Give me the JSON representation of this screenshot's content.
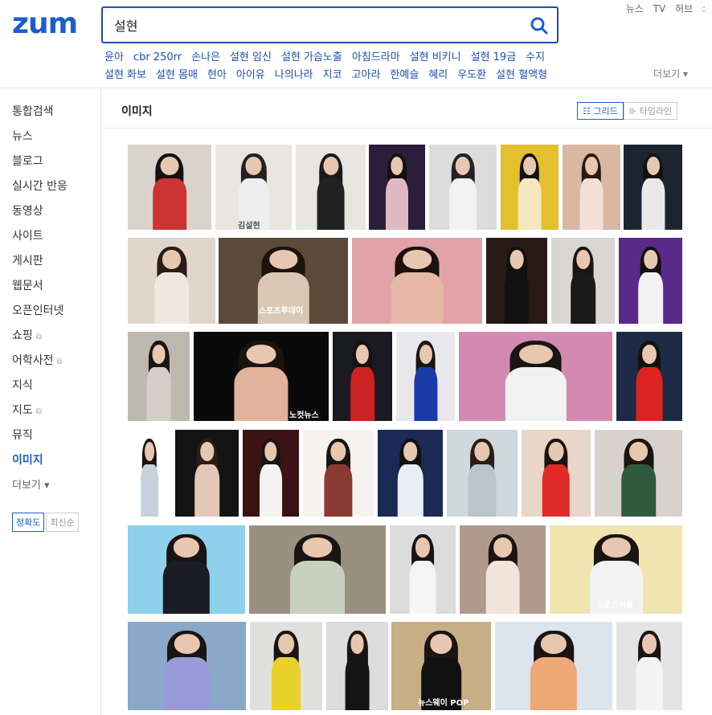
{
  "header": {
    "logo": "zum",
    "search_value": "설현",
    "top_links": [
      "뉴스",
      "TV",
      "허브",
      ":"
    ],
    "related_row1": [
      "윤아",
      "cbr 250rr",
      "손나은",
      "설현 임신",
      "설현 가슴노출",
      "아침드라마",
      "설현 비키니",
      "설현 19금",
      "수지"
    ],
    "related_row2": [
      "설현 화보",
      "설현 몸매",
      "현아",
      "아이유",
      "나의나라",
      "지코",
      "고아라",
      "한예슬",
      "혜리",
      "우도환",
      "설현 혈액형"
    ],
    "more_label": "더보기 ▾"
  },
  "sidebar": {
    "items": [
      {
        "label": "통합검색"
      },
      {
        "label": "뉴스"
      },
      {
        "label": "블로그"
      },
      {
        "label": "실시간 반응"
      },
      {
        "label": "동영상"
      },
      {
        "label": "사이트"
      },
      {
        "label": "게시판"
      },
      {
        "label": "웹문서"
      },
      {
        "label": "오픈인터넷"
      },
      {
        "label": "쇼핑",
        "ext": "⧉"
      },
      {
        "label": "어학사전",
        "ext": "⧉"
      },
      {
        "label": "지식"
      },
      {
        "label": "지도",
        "ext": "⧉"
      },
      {
        "label": "뮤직"
      },
      {
        "label": "이미지"
      },
      {
        "label": "더보기 ▾"
      }
    ],
    "sort": [
      "정확도",
      "최신순"
    ]
  },
  "main": {
    "section_title": "이미지",
    "view_grid": "☷ 그리드",
    "view_timeline": "⊪ 타임라인"
  },
  "colors": {
    "accent": "#1a5dd1",
    "search_border": "#1d4eb0"
  },
  "image_captions": {
    "c1": "김설현",
    "c2": "스포츠투데이",
    "c3": "노컷뉴스",
    "c4": "스포츠서울",
    "c5": "뉴스웨이 POP"
  }
}
